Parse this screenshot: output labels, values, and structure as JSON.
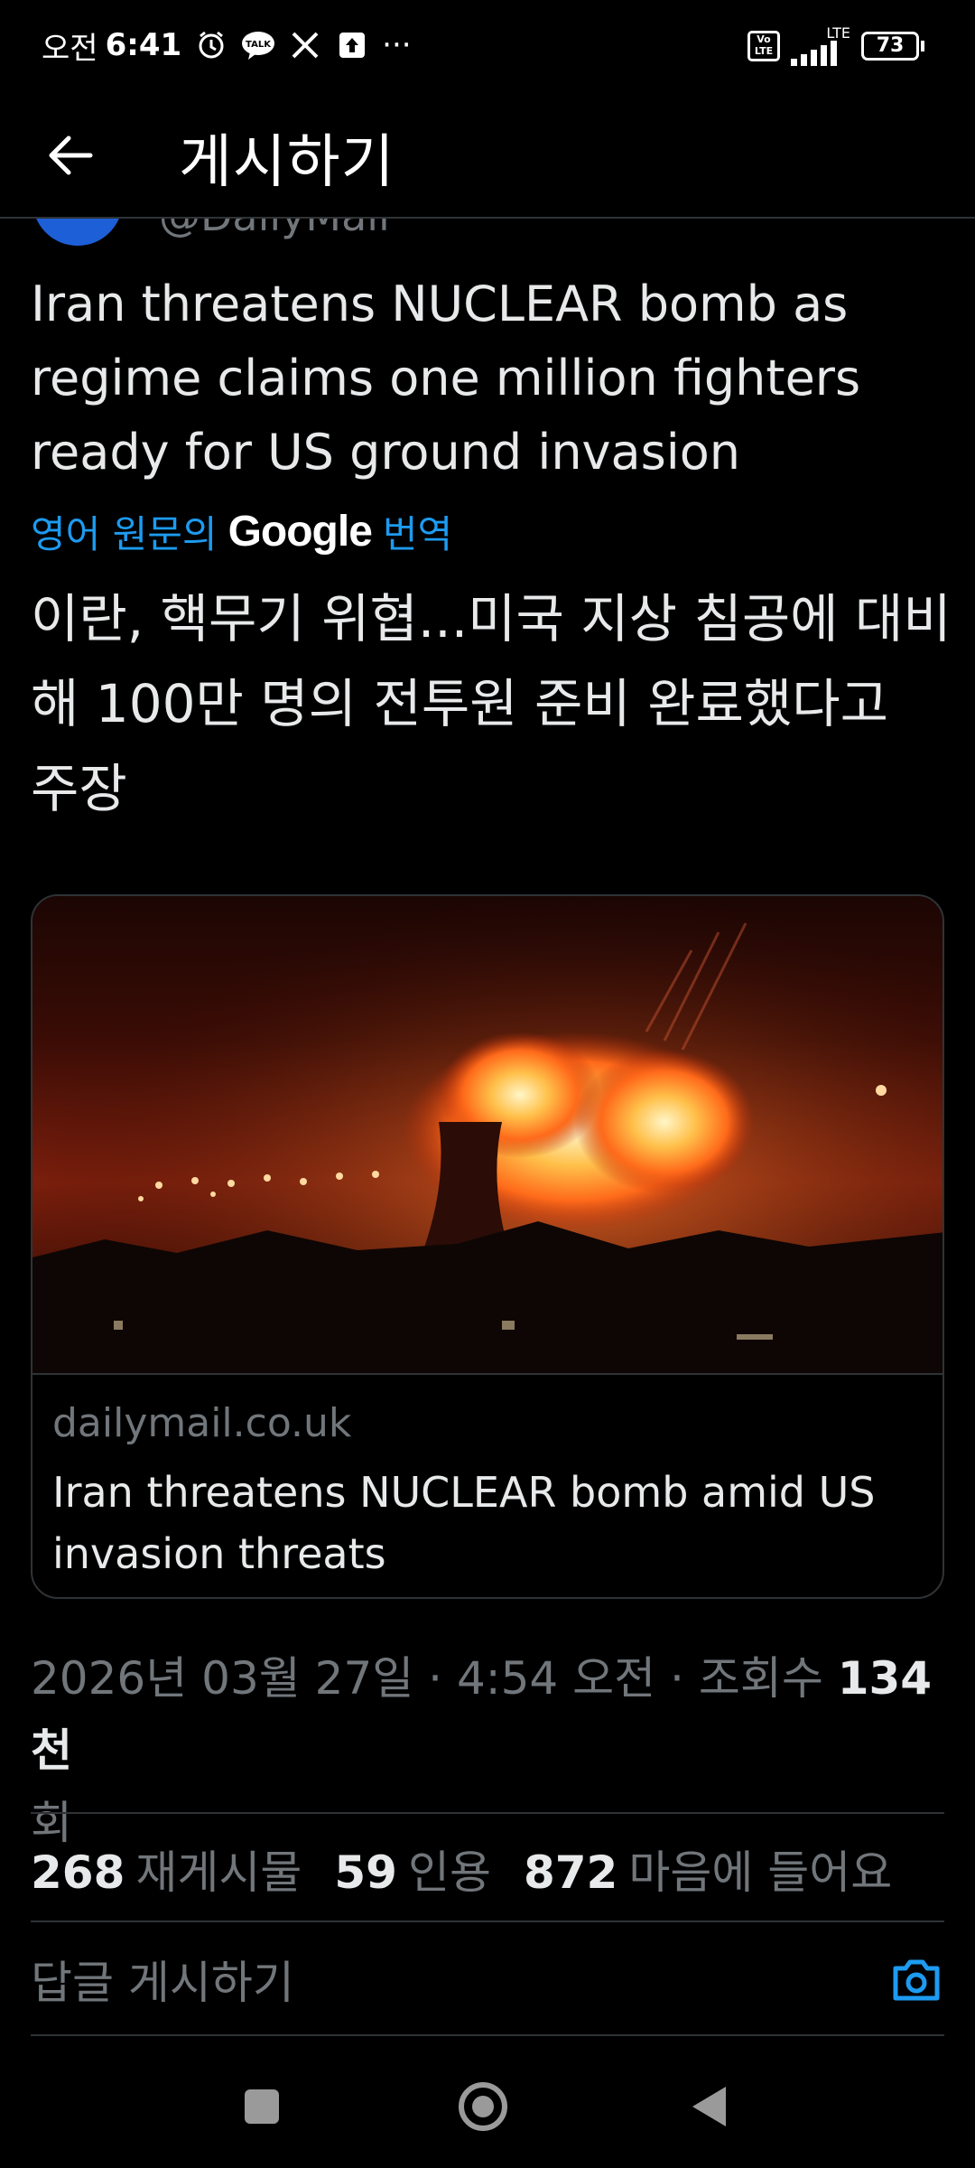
{
  "status_bar": {
    "ampm": "오전",
    "time": "6:41",
    "talk_label": "TALK",
    "more": "···",
    "volte": "Vo LTE",
    "network": "LTE",
    "battery": "73"
  },
  "header": {
    "title": "게시하기"
  },
  "author": {
    "handle": "@DailyMail"
  },
  "tweet": {
    "text": "Iran threatens NUCLEAR bomb as regime claims one million fighters ready for US ground invasion",
    "translate_prefix": "영어 원문의",
    "translate_brand": "Google",
    "translate_suffix": "번역",
    "translated_text": "이란, 핵무기 위협...미국 지상 침공에 대비해 100만 명의 전투원 준비 완료했다고 주장"
  },
  "link_card": {
    "domain": "dailymail.co.uk",
    "title": "Iran threatens NUCLEAR bomb amid US invasion threats"
  },
  "meta": {
    "datetime": "2026년 03월 27일 · 4:54 오전 · 조회수 ",
    "views": "134천",
    "views_suffix": "회"
  },
  "stats": {
    "reposts_count": "268",
    "reposts_label": "재게시물",
    "quotes_count": "59",
    "quotes_label": "인용",
    "likes_count": "872",
    "likes_label": "마음에 들어요"
  },
  "reply": {
    "placeholder": "답글 게시하기"
  },
  "colors": {
    "accent": "#1d9bf0",
    "background": "#000000",
    "muted": "#71767b",
    "divider": "#2f3336"
  }
}
